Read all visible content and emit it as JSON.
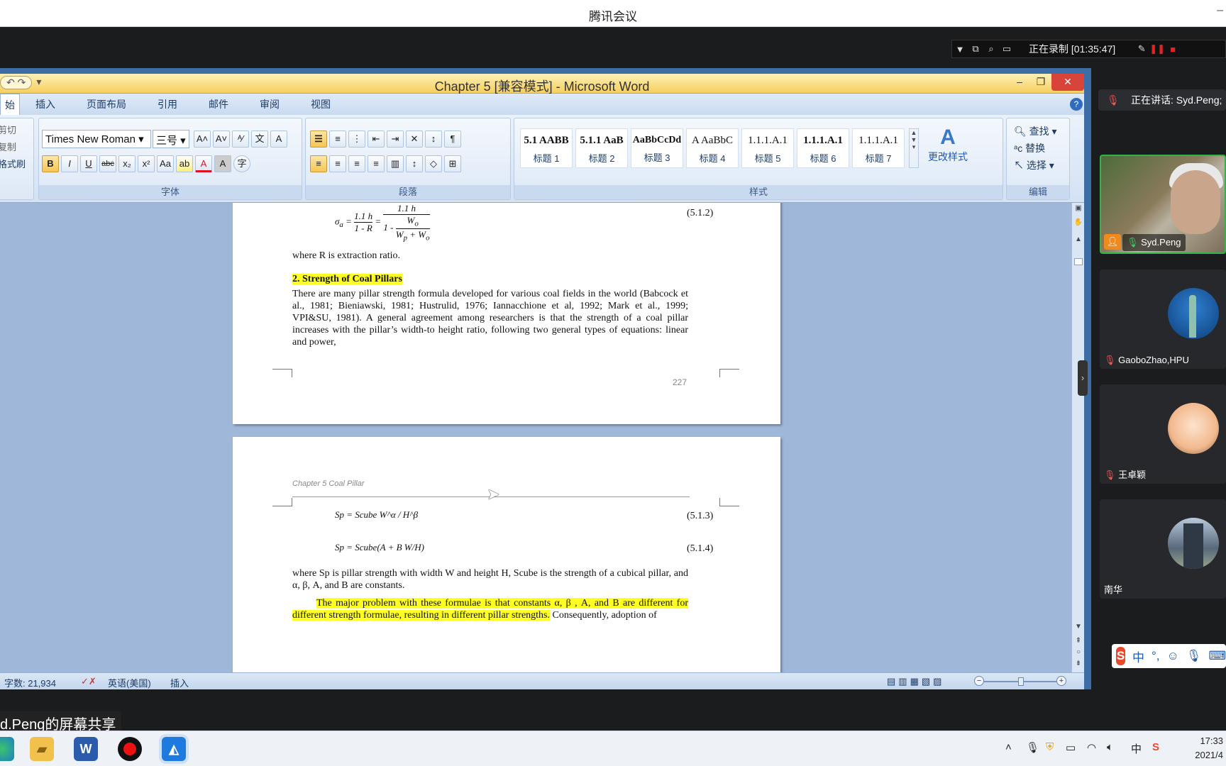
{
  "meeting": {
    "app_title": "腾讯会议",
    "minimize": "–",
    "recording_text": "正在录制 [01:35:47]",
    "share_label": "d.Peng的屏幕共享",
    "speaking_label": "正在讲话: Syd.Peng;"
  },
  "participants": [
    {
      "name": "Syd.Peng"
    },
    {
      "name": "GaoboZhao,HPU"
    },
    {
      "name": "王卓颖"
    },
    {
      "name": "南华"
    }
  ],
  "word": {
    "title": "Chapter 5 [兼容模式] - Microsoft Word",
    "tabs": [
      "始",
      "插入",
      "页面布局",
      "引用",
      "邮件",
      "审阅",
      "视图"
    ],
    "clipboard": {
      "cut": "剪切",
      "copy": "复制",
      "format_painter": "格式刷"
    },
    "font": {
      "name": "Times New Roman",
      "size": "三号",
      "group_label": "字体"
    },
    "paragraph_label": "段落",
    "styles_label": "样式",
    "styles": [
      {
        "sample": "5.1  AABB",
        "name": "标题 1"
      },
      {
        "sample": "5.1.1  AaB",
        "name": "标题 2"
      },
      {
        "sample": "AaBbCcDd",
        "name": "标题 3"
      },
      {
        "sample": "A  AaBbC",
        "name": "标题 4"
      },
      {
        "sample": "1.1.1.A.1",
        "name": "标题 5"
      },
      {
        "sample": "1.1.1.A.1",
        "name": "标题 6"
      },
      {
        "sample": "1.1.1.A.1",
        "name": "标题 7"
      }
    ],
    "change_styles": "更改样式",
    "editing": {
      "find": "查找",
      "replace": "替换",
      "select": "选择",
      "group_label": "编辑"
    },
    "status": {
      "word_count": "字数: 21,934",
      "language": "英语(美国)",
      "mode": "插入"
    }
  },
  "document": {
    "page1": {
      "eq_5_1_2_num": "(5.1.2)",
      "where_r": "where R is extraction ratio.",
      "heading": "2. Strength of Coal Pillars",
      "body": "There are many pillar strength formula developed for various coal fields in the world (Babcock et al., 1981; Bieniawski, 1981; Hustrulid, 1976; Iannacchione et al, 1992; Mark et al., 1999; VPI&SU, 1981). A general agreement among researchers is that the strength of a coal pillar increases with the pillar’s width-to height ratio, following two general types of equations: linear and power,",
      "page_number": "227"
    },
    "page2": {
      "header": "Chapter 5 Coal Pillar",
      "eq_5_1_3": "Sp = Scube W^α / H^β",
      "eq_5_1_3_num": "(5.1.3)",
      "eq_5_1_4": "Sp = Scube(A + B W/H)",
      "eq_5_1_4_num": "(5.1.4)",
      "where_text": "where Sp is pillar strength with width W and height H, Scube is the strength of a cubical pillar, and α, β, A, and B are constants.",
      "hl_text": "The major problem with these formulae is that constants α, β , A, and B are different for different strength formulae, resulting in different pillar strengths.",
      "tail_text": " Consequently, adoption of"
    }
  },
  "taskbar": {
    "time": "17:33",
    "date": "2021/4",
    "ime": "中"
  }
}
